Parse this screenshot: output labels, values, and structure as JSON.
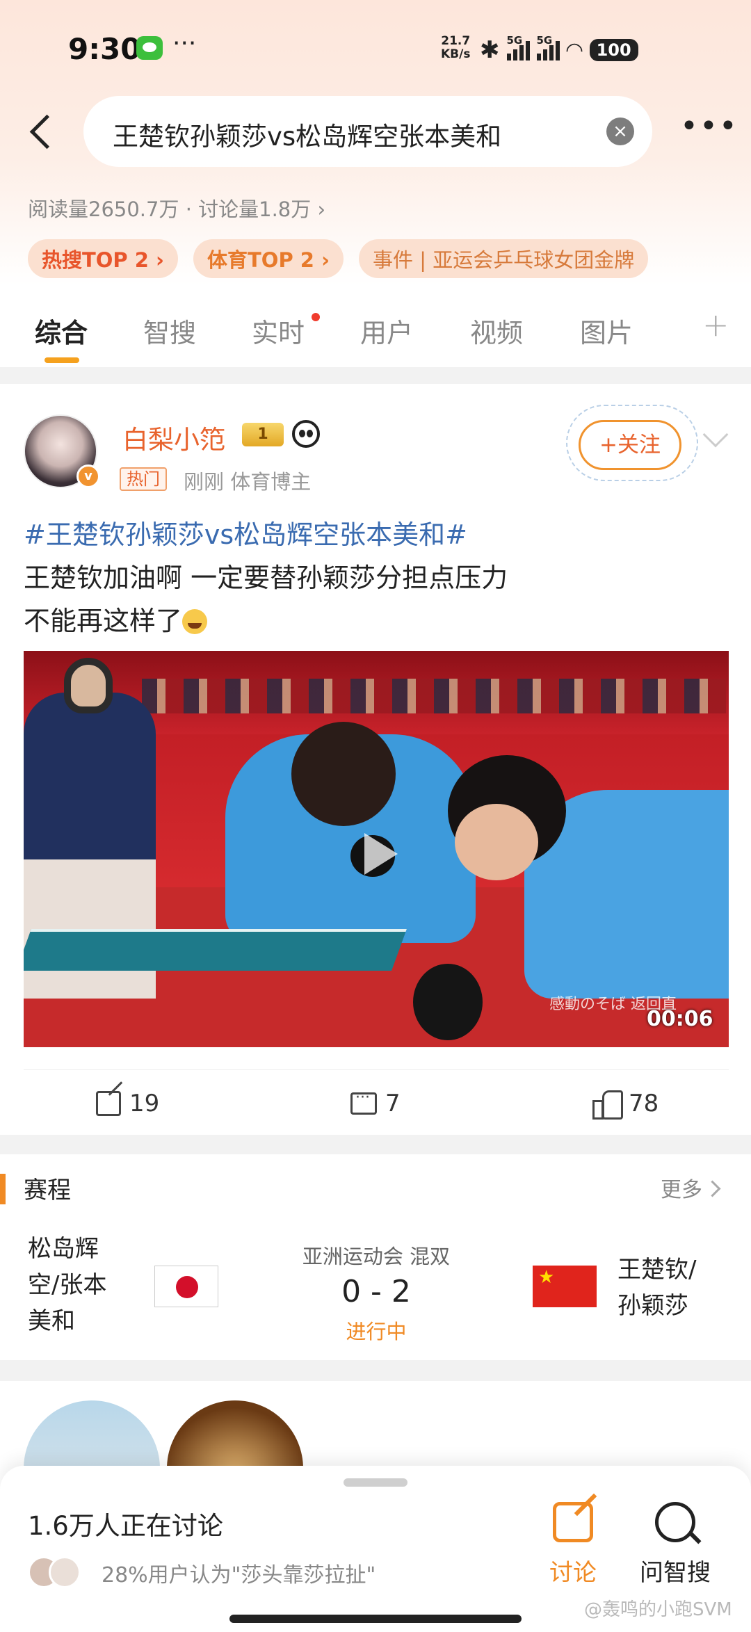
{
  "status_bar": {
    "time": "9:30",
    "net_speed_value": "21.7",
    "net_speed_unit": "KB/s",
    "signal1": "5G",
    "signal2": "5G",
    "battery": "100"
  },
  "header": {
    "search_query": "王楚钦孙颖莎vs松岛辉空张本美和",
    "stats": "阅读量2650.7万 · 讨论量1.8万 ›",
    "tags": [
      {
        "label": "热搜TOP 2 ›"
      },
      {
        "label": "体育TOP 2 ›"
      },
      {
        "label": "事件 | 亚运会乒乓球女团金牌"
      }
    ]
  },
  "tabs": [
    {
      "label": "综合",
      "active": true
    },
    {
      "label": "智搜"
    },
    {
      "label": "实时"
    },
    {
      "label": "用户"
    },
    {
      "label": "视频"
    },
    {
      "label": "图片"
    }
  ],
  "post": {
    "username": "白梨小笵",
    "level_badge": "1",
    "hot_badge": "热门",
    "meta": "刚刚   体育博主",
    "follow_label": "+关注",
    "hashtag": "#王楚钦孙颖莎vs松岛辉空张本美和#",
    "text_line1": "王楚钦加油啊 一定要替孙颖莎分担点压力",
    "text_line2": "不能再这样了",
    "video": {
      "duration": "00:06",
      "caption": "感動のそば 返回直"
    },
    "actions": {
      "reposts": "19",
      "comments": "7",
      "likes": "78"
    }
  },
  "schedule": {
    "title": "赛程",
    "more_label": "更多",
    "team1": "松岛辉空/张本美和",
    "team1_lines": [
      "松岛辉",
      "空/张本",
      "美和"
    ],
    "match_name": "亚洲运动会 混双",
    "score": "0 - 2",
    "match_status": "进行中",
    "team2_lines": [
      "王楚钦/",
      "孙颖莎"
    ]
  },
  "discussion": {
    "count_text": "1.6万人正在讨论",
    "opinion": "28%用户认为\"莎头靠莎拉扯\"",
    "discuss_label": "讨论",
    "ai_search_label": "问智搜"
  },
  "watermark": "@轰鸣的小跑SVM",
  "colors": {
    "accent": "#f08a24",
    "username": "#e8632d",
    "hashtag": "#3a6bb0"
  }
}
